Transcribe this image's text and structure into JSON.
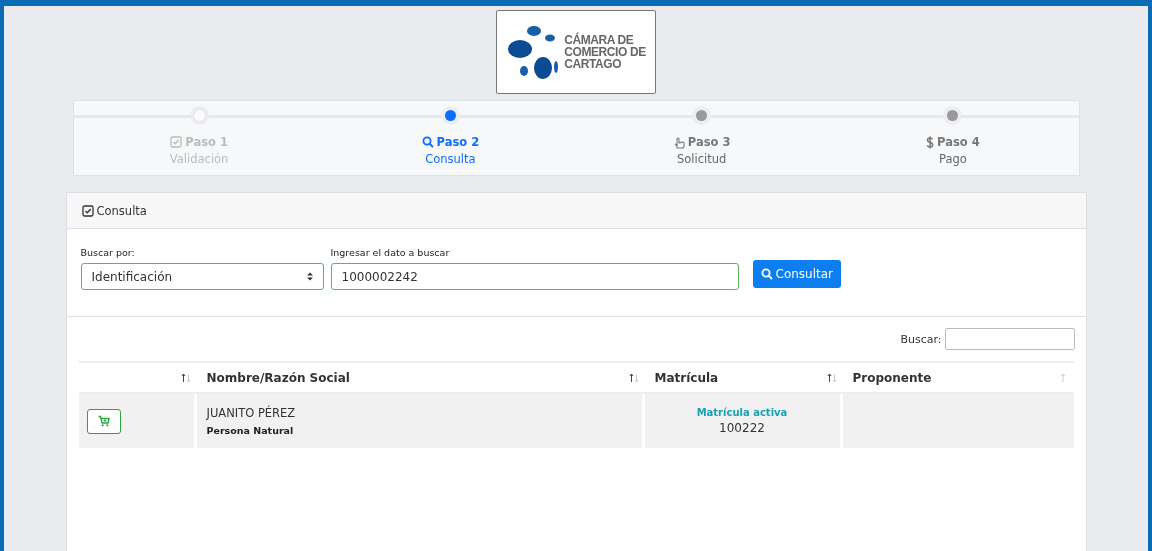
{
  "logo": {
    "lines": [
      "CÁMARA DE",
      "COMERCIO DE",
      "CARTAGO"
    ]
  },
  "steps": [
    {
      "title": "Paso 1",
      "subtitle": "Validación",
      "completed": true,
      "selected": false
    },
    {
      "title": "Paso 2",
      "subtitle": "Consulta",
      "completed": false,
      "selected": true
    },
    {
      "title": "Paso 3",
      "subtitle": "Solicitud",
      "completed": false,
      "selected": false
    },
    {
      "title": "Paso 4",
      "subtitle": "Pago",
      "completed": false,
      "selected": false
    }
  ],
  "card": {
    "title": "Consulta",
    "search_by": {
      "label": "Buscar por:",
      "value": "Identificación"
    },
    "query": {
      "label": "Ingresar el dato a buscar",
      "value": "1000002242"
    },
    "submit": "Consultar"
  },
  "table": {
    "filter_label": "Buscar:",
    "columns": [
      {
        "kind": "sortable"
      },
      {
        "label": "Nombre/Razón Social",
        "kind": "sortable"
      },
      {
        "label": "Matrícula",
        "kind": "sortable"
      },
      {
        "label": "Proponente",
        "kind": "ascending"
      }
    ],
    "rows": [
      {
        "name": "JUANITO PÉREZ",
        "type": "Persona Natural",
        "status": "Matrícula activa",
        "number": "100222"
      }
    ]
  }
}
